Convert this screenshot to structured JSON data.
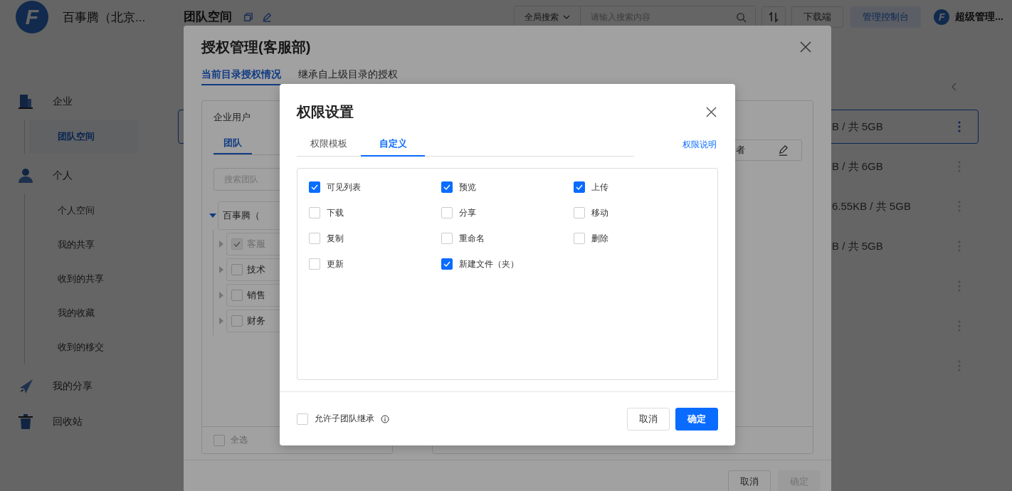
{
  "header": {
    "logo": "F",
    "company": "百事腾（北京...",
    "title": "团队空间",
    "search_scope": "全局搜索",
    "search_placeholder": "请输入搜索内容",
    "download_button": "下载端",
    "console_button": "管理控制台",
    "avatar": "F",
    "user": "超级管理..."
  },
  "sidebar": [
    {
      "label": "企业",
      "children": [
        {
          "label": "团队空间",
          "selected": true
        }
      ]
    },
    {
      "label": "个人",
      "children": [
        {
          "label": "个人空间",
          "selected": false
        },
        {
          "label": "我的共享",
          "selected": false
        },
        {
          "label": "收到的共享",
          "selected": false
        },
        {
          "label": "我的收藏",
          "selected": false
        },
        {
          "label": "收到的移交",
          "selected": false
        }
      ]
    },
    {
      "label": "我的分享"
    },
    {
      "label": "回收站"
    }
  ],
  "storage_rows": [
    {
      "usage": "B / 共 5GB",
      "selected": true
    },
    {
      "usage": "B / 共 6GB",
      "selected": false
    },
    {
      "usage": "6.55KB / 共 5GB",
      "selected": false
    },
    {
      "usage": "B / 共 5GB",
      "selected": false
    },
    {
      "selected": false
    },
    {
      "selected": false
    },
    {
      "selected": false
    }
  ],
  "auth_dialog": {
    "title": "授权管理(客服部)",
    "tabs": [
      {
        "label": "当前目录授权情况",
        "selected": true
      },
      {
        "label": "继承自上级目录的授权",
        "selected": false
      }
    ],
    "users_panel": {
      "title": "企业用户",
      "tabs": [
        {
          "label": "团队",
          "selected": true
        }
      ],
      "search_placeholder": "搜索团队",
      "tree": [
        {
          "label": "百事腾（",
          "expanded": true,
          "children": [
            {
              "label": "客服",
              "checked": true,
              "disabled": true
            },
            {
              "label": "技术",
              "checked": false,
              "disabled": false
            },
            {
              "label": "销售",
              "checked": false,
              "disabled": false
            },
            {
              "label": "财务",
              "checked": false,
              "disabled": false
            }
          ]
        }
      ],
      "select_all": {
        "label": "全选",
        "checked": false
      }
    },
    "role_field": {
      "value": "者"
    },
    "buttons": [
      {
        "label": "取消",
        "kind": "default",
        "disabled": false
      },
      {
        "label": "确定",
        "kind": "primary",
        "disabled": true
      }
    ]
  },
  "permission_dialog": {
    "title": "权限设置",
    "tabs": [
      {
        "label": "权限模板",
        "selected": false
      },
      {
        "label": "自定义",
        "selected": true
      }
    ],
    "help_link": "权限说明",
    "permissions": [
      {
        "label": "可见列表",
        "checked": true
      },
      {
        "label": "预览",
        "checked": true
      },
      {
        "label": "上传",
        "checked": true
      },
      {
        "label": "下载",
        "checked": false
      },
      {
        "label": "分享",
        "checked": false
      },
      {
        "label": "移动",
        "checked": false
      },
      {
        "label": "复制",
        "checked": false
      },
      {
        "label": "重命名",
        "checked": false
      },
      {
        "label": "删除",
        "checked": false
      },
      {
        "label": "更新",
        "checked": false
      },
      {
        "label": "新建文件（夹）",
        "checked": true
      }
    ],
    "inherit": {
      "label": "允许子团队继承",
      "checked": false
    },
    "buttons": [
      {
        "label": "取消",
        "kind": "default",
        "disabled": false
      },
      {
        "label": "确定",
        "kind": "primary",
        "disabled": false
      }
    ]
  }
}
